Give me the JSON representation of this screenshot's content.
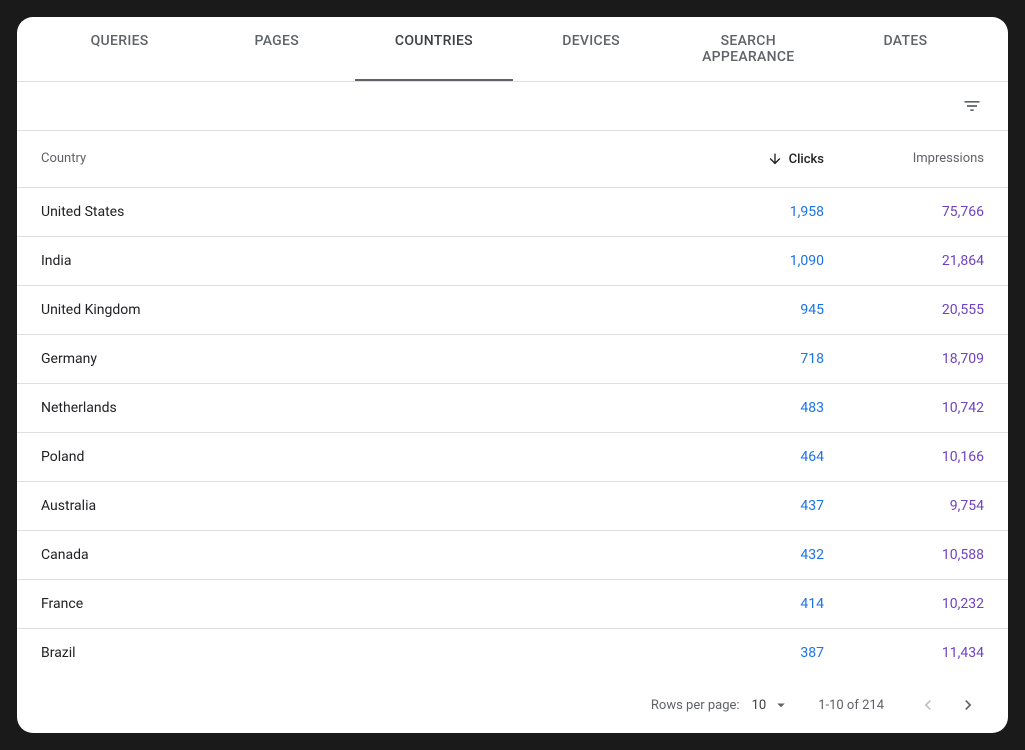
{
  "tabs": [
    {
      "label": "QUERIES",
      "active": false
    },
    {
      "label": "PAGES",
      "active": false
    },
    {
      "label": "COUNTRIES",
      "active": true
    },
    {
      "label": "DEVICES",
      "active": false
    },
    {
      "label": "SEARCH APPEARANCE",
      "active": false
    },
    {
      "label": "DATES",
      "active": false
    }
  ],
  "headers": {
    "country": "Country",
    "clicks": "Clicks",
    "impressions": "Impressions"
  },
  "sort": {
    "column": "clicks",
    "direction": "desc"
  },
  "rows": [
    {
      "country": "United States",
      "clicks": "1,958",
      "impressions": "75,766"
    },
    {
      "country": "India",
      "clicks": "1,090",
      "impressions": "21,864"
    },
    {
      "country": "United Kingdom",
      "clicks": "945",
      "impressions": "20,555"
    },
    {
      "country": "Germany",
      "clicks": "718",
      "impressions": "18,709"
    },
    {
      "country": "Netherlands",
      "clicks": "483",
      "impressions": "10,742"
    },
    {
      "country": "Poland",
      "clicks": "464",
      "impressions": "10,166"
    },
    {
      "country": "Australia",
      "clicks": "437",
      "impressions": "9,754"
    },
    {
      "country": "Canada",
      "clicks": "432",
      "impressions": "10,588"
    },
    {
      "country": "France",
      "clicks": "414",
      "impressions": "10,232"
    },
    {
      "country": "Brazil",
      "clicks": "387",
      "impressions": "11,434"
    }
  ],
  "pagination": {
    "rows_per_page_label": "Rows per page:",
    "rows_per_page_value": "10",
    "range_label": "1-10 of 214",
    "prev_disabled": true,
    "next_disabled": false
  }
}
